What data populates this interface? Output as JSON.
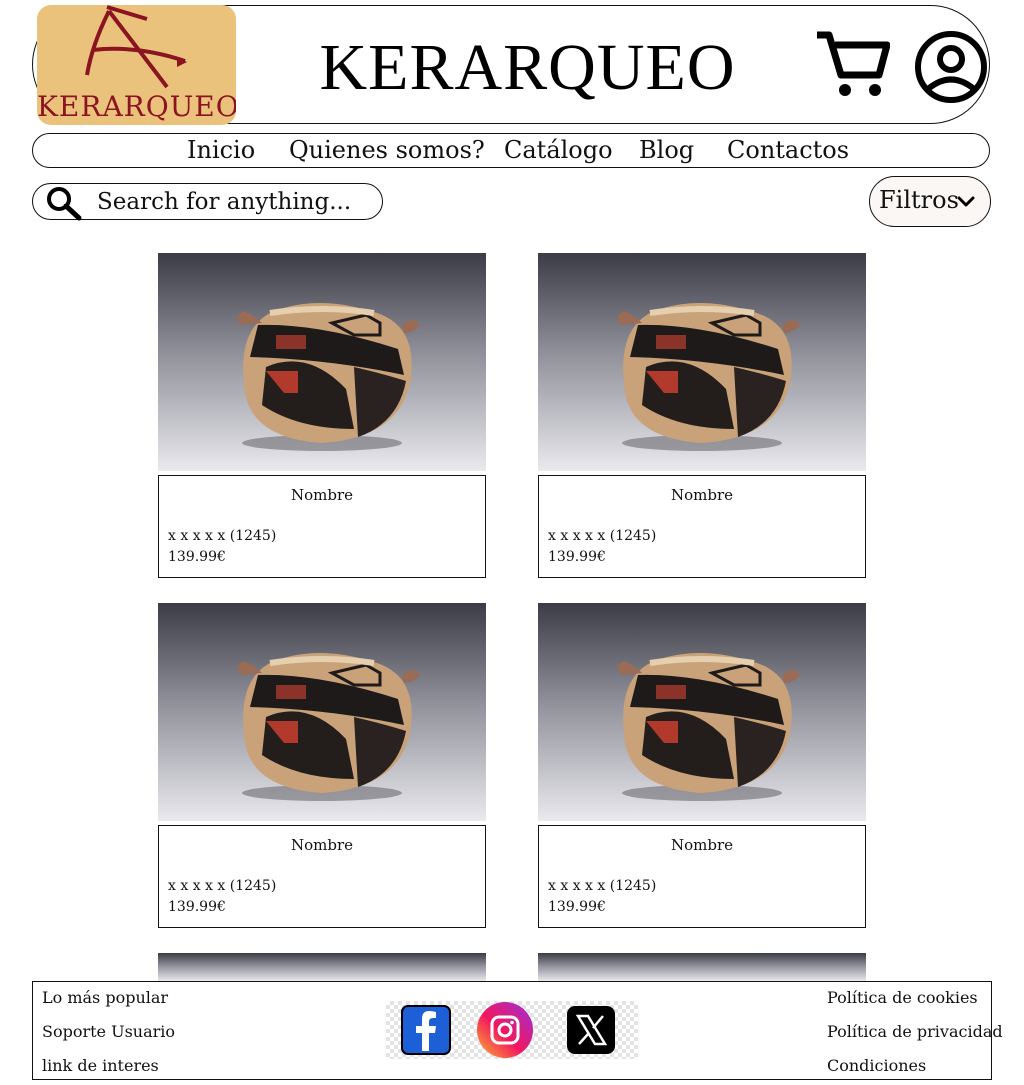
{
  "brand": {
    "logo_text": "KERARQUEO",
    "site_title": "KERARQUEO",
    "logo_bg": "#ebc27c",
    "logo_color": "#8a1420"
  },
  "header_icons": [
    "cart-icon",
    "account-icon"
  ],
  "nav": {
    "items": [
      {
        "label": "Inicio"
      },
      {
        "label": "Quienes somos?"
      },
      {
        "label": "Catálogo"
      },
      {
        "label": "Blog"
      },
      {
        "label": "Contactos"
      }
    ]
  },
  "search": {
    "placeholder": "Search for anything..."
  },
  "filter": {
    "label": "Filtros"
  },
  "products": [
    {
      "name": "Nombre",
      "rating": "x x x x x (1245)",
      "price": "139.99€"
    },
    {
      "name": "Nombre",
      "rating": "x x x x x (1245)",
      "price": "139.99€"
    },
    {
      "name": "Nombre",
      "rating": "x x x x x (1245)",
      "price": "139.99€"
    },
    {
      "name": "Nombre",
      "rating": "x x x x x (1245)",
      "price": "139.99€"
    }
  ],
  "footer": {
    "left_links": [
      "Lo más popular",
      "Soporte Usuario",
      "link de interes"
    ],
    "right_links": [
      "Política de cookies",
      "Política de privacidad",
      "Condiciones"
    ],
    "social": [
      "facebook-icon",
      "instagram-icon",
      "x-icon"
    ]
  }
}
